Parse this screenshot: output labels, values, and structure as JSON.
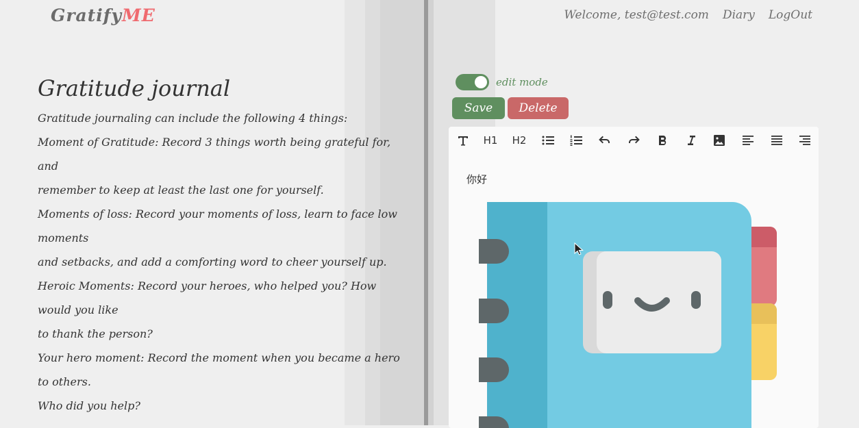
{
  "app": {
    "logo_main": "Gratify",
    "logo_accent": "ME"
  },
  "nav": {
    "welcome": "Welcome, test@test.com",
    "diary": "Diary",
    "logout": "LogOut"
  },
  "journal": {
    "title": "Gratitude journal",
    "lines": [
      "Gratitude journaling can include the following 4 things:",
      "Moment of Gratitude: Record 3 things worth being grateful for, and",
      "remember to keep at least the last one for yourself.",
      "Moments of loss: Record your moments of loss, learn to face low moments",
      "and setbacks, and add a comforting word to cheer yourself up.",
      "Heroic Moments: Record your heroes, who helped you? How would you like",
      "to thank the person?",
      "Your hero moment: Record the moment when you became a hero to others.",
      "Who did you help?"
    ]
  },
  "editor": {
    "edit_mode_label": "edit mode",
    "edit_mode_on": true,
    "save_label": "Save",
    "delete_label": "Delete",
    "toolbar": {
      "h1": "H1",
      "h2": "H2"
    },
    "content_text": "你好"
  },
  "colors": {
    "accent_green": "#5f8f5f",
    "delete_red": "#c96868",
    "logo_accent": "#ef6a6f"
  }
}
